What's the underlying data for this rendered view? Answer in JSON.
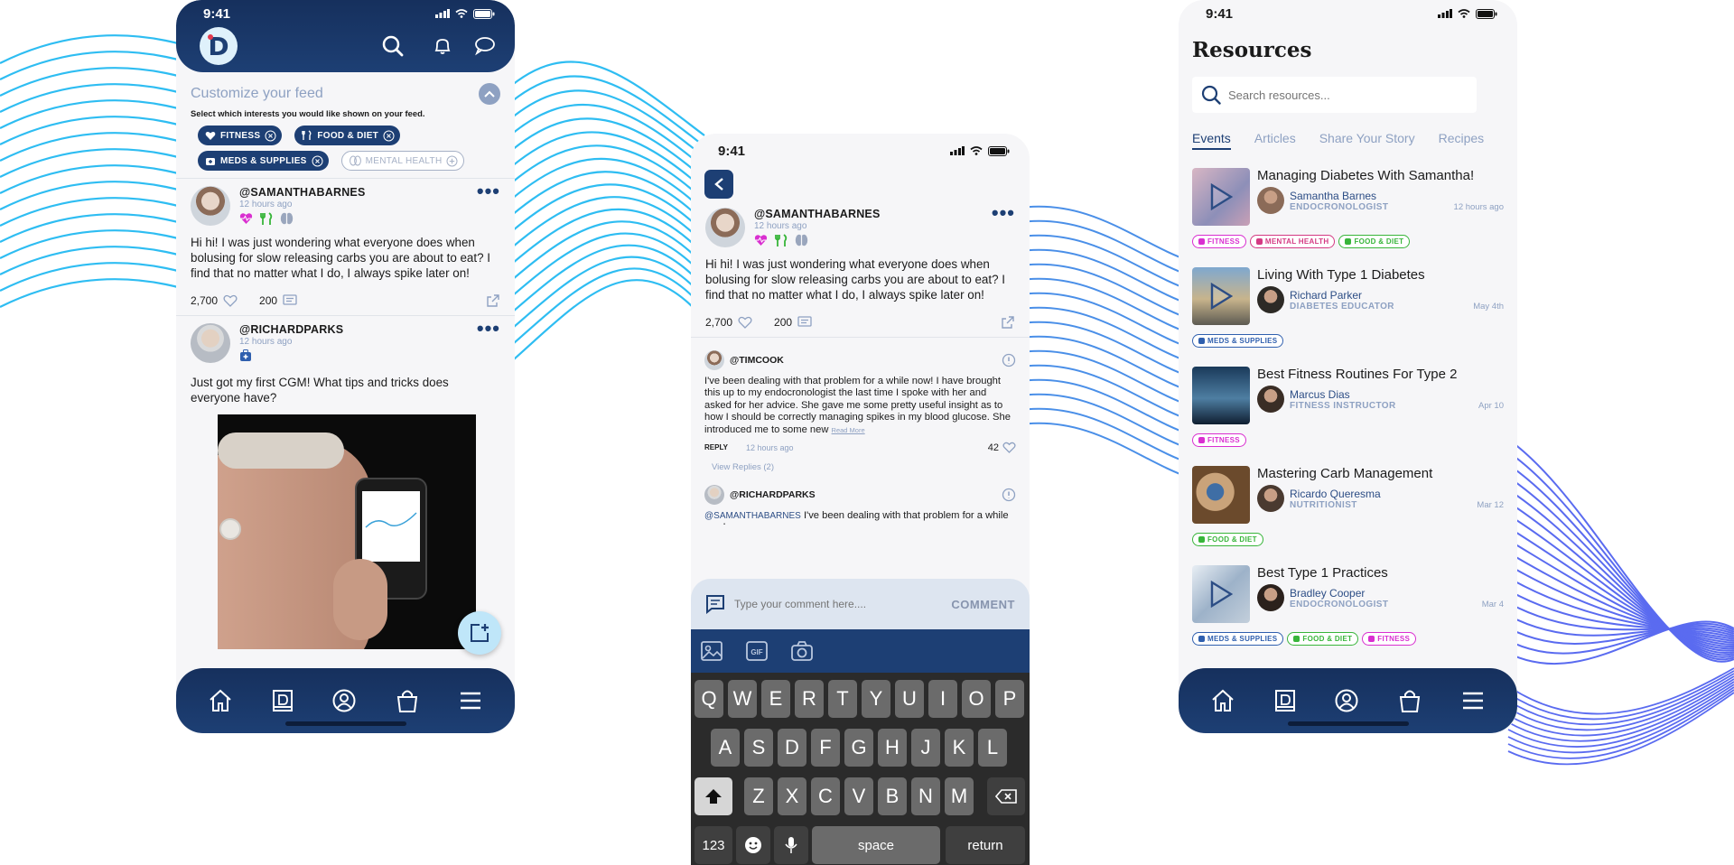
{
  "status_time": "9:41",
  "feed": {
    "customize_title": "Customize your feed",
    "customize_sub": "Select which interests you would like shown on your feed.",
    "chips": [
      {
        "label": "FITNESS",
        "on": true,
        "icon": "heart-pulse-icon"
      },
      {
        "label": "FOOD & DIET",
        "on": true,
        "icon": "utensils-icon"
      },
      {
        "label": "MEDS & SUPPLIES",
        "on": true,
        "icon": "medkit-icon"
      },
      {
        "label": "MENTAL HEALTH",
        "on": false,
        "icon": "brain-icon"
      }
    ],
    "posts": [
      {
        "user": "@SAMANTHABARNES",
        "ago": "12 hours ago",
        "text": "Hi hi! I was just wondering what everyone does when bolusing for slow releasing carbs you are about to eat?  I find that no matter what I do, I always spike later on!",
        "likes": "2,700",
        "comments": "200"
      },
      {
        "user": "@RICHARDPARKS",
        "ago": "12 hours ago",
        "text": "Just got my first CGM! What tips and tricks does everyone have?"
      }
    ]
  },
  "detail": {
    "post": {
      "user": "@SAMANTHABARNES",
      "ago": "12 hours ago",
      "text": "Hi hi! I was just wondering what everyone does when bolusing for slow releasing carbs you are about to eat?  I find that no matter what I do, I always spike later on!",
      "likes": "2,700",
      "comments": "200"
    },
    "comment1": {
      "user": "@TIMCOOK",
      "text": "I've been dealing with that problem for a while now!  I have brought this up to my endocronologist the last time I spoke with her and asked for her advice.  She gave me some pretty useful insight as to how I should be correctly managing spikes in my blood glucose.  She introduced me to some new",
      "read_more": "Read More",
      "reply": "REPLY",
      "ago": "12 hours ago",
      "likes": "42",
      "view_replies": "View Replies (2)"
    },
    "comment2": {
      "user": "@RICHARDPARKS",
      "mention": "@SAMANTHABARNES",
      "text": " I've been dealing with that problem for a while now!"
    },
    "input_placeholder": "Type your comment here....",
    "comment_button": "COMMENT",
    "keyboard": {
      "row1": [
        "Q",
        "W",
        "E",
        "R",
        "T",
        "Y",
        "U",
        "I",
        "O",
        "P"
      ],
      "row2": [
        "A",
        "S",
        "D",
        "F",
        "G",
        "H",
        "J",
        "K",
        "L"
      ],
      "row3": [
        "Z",
        "X",
        "C",
        "V",
        "B",
        "N",
        "M"
      ],
      "num": "123",
      "space": "space",
      "return": "return"
    }
  },
  "resources": {
    "title": "Resources",
    "search_placeholder": "Search resources...",
    "tabs": [
      "Events",
      "Articles",
      "Share Your Story",
      "Recipes"
    ],
    "items": [
      {
        "title": "Managing Diabetes With Samantha!",
        "name": "Samantha Barnes",
        "role": "ENDOCRONOLOGIST",
        "date": "12 hours ago",
        "tags": [
          "FITNESS",
          "MENTAL HEALTH",
          "FOOD & DIET"
        ]
      },
      {
        "title": "Living With Type 1 Diabetes",
        "name": "Richard Parker",
        "role": "DIABETES EDUCATOR",
        "date": "May 4th",
        "tags": [
          "MEDS & SUPPLIES"
        ]
      },
      {
        "title": "Best Fitness Routines For Type 2",
        "name": "Marcus Dias",
        "role": "FITNESS INSTRUCTOR",
        "date": "Apr 10",
        "tags": [
          "FITNESS"
        ]
      },
      {
        "title": "Mastering Carb Management",
        "name": "Ricardo Queresma",
        "role": "NUTRITIONIST",
        "date": "Mar 12",
        "tags": [
          "FOOD & DIET"
        ]
      },
      {
        "title": "Best Type 1 Practices",
        "name": "Bradley Cooper",
        "role": "ENDOCRONOLOGIST",
        "date": "Mar 4",
        "tags": [
          "MEDS & SUPPLIES",
          "FOOD & DIET",
          "FITNESS"
        ]
      }
    ]
  },
  "colors": {
    "navy": "#1d3f74",
    "fitness": "#d92fd0",
    "food": "#38b53a",
    "meds": "#2f5fae",
    "mental": "#d43a83",
    "wave": "#2ebdf2"
  }
}
